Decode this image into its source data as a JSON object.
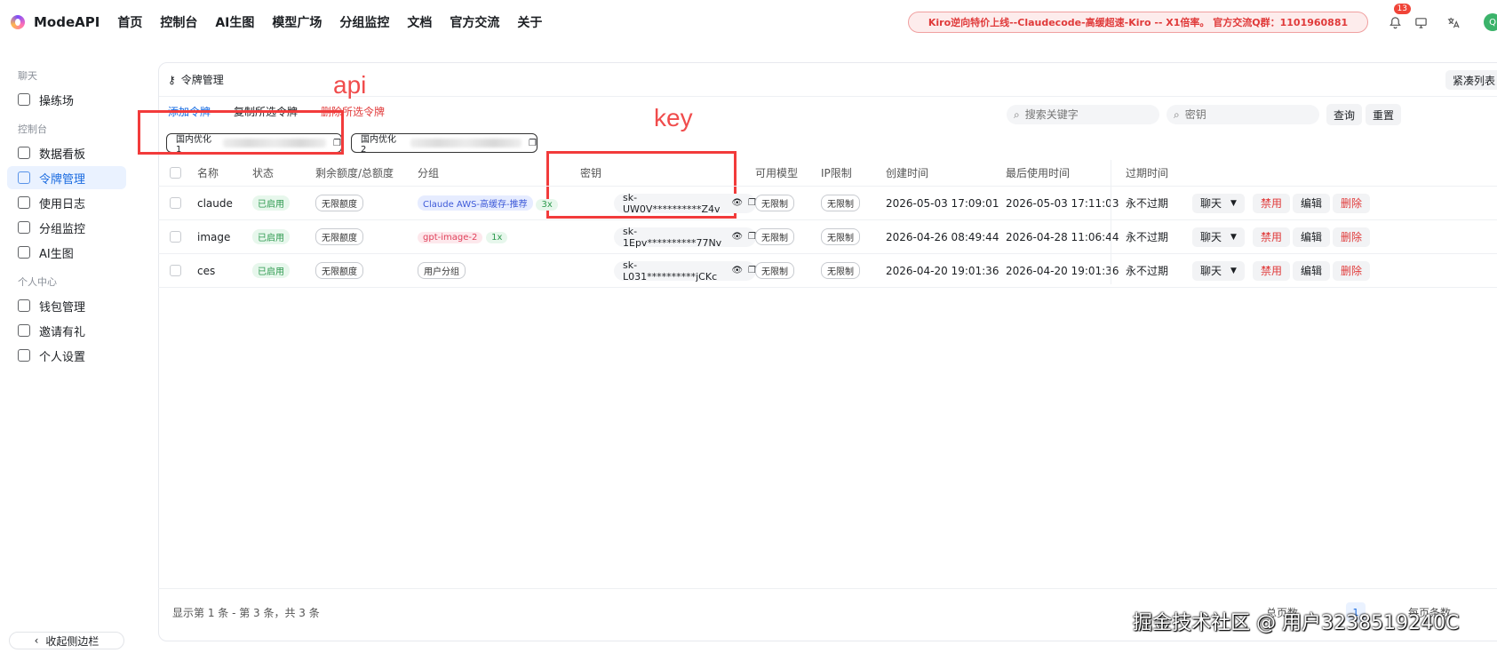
{
  "app": {
    "name": "ModeAPI"
  },
  "nav": [
    "首页",
    "控制台",
    "AI生图",
    "模型广场",
    "分组监控",
    "文档",
    "官方交流",
    "关于"
  ],
  "announcement": "Kiro逆向特价上线--Claudecode-高缓超速-Kiro -- X1倍率。 官方交流Q群：1101960881",
  "notifications": {
    "count": "13"
  },
  "avatar": {
    "initial": "Q"
  },
  "sidebar": {
    "groups": [
      {
        "label": "聊天",
        "items": [
          {
            "label": "操练场",
            "icon": "playground-icon"
          }
        ]
      },
      {
        "label": "控制台",
        "items": [
          {
            "label": "数据看板",
            "icon": "dashboard-icon"
          },
          {
            "label": "令牌管理",
            "icon": "key-icon",
            "active": true
          },
          {
            "label": "使用日志",
            "icon": "chart-icon"
          },
          {
            "label": "分组监控",
            "icon": "pulse-icon"
          },
          {
            "label": "AI生图",
            "icon": "image-icon"
          }
        ]
      },
      {
        "label": "个人中心",
        "items": [
          {
            "label": "钱包管理",
            "icon": "wallet-icon"
          },
          {
            "label": "邀请有礼",
            "icon": "gift-icon"
          },
          {
            "label": "个人设置",
            "icon": "user-icon"
          }
        ]
      }
    ],
    "collapse_label": "收起侧边栏"
  },
  "page": {
    "title": "令牌管理",
    "compact_label": "紧凑列表",
    "actions": {
      "add": "添加令牌",
      "copy": "复制所选令牌",
      "delete": "删除所选令牌"
    },
    "search": {
      "keyword_placeholder": "搜索关键字",
      "key_placeholder": "密钥",
      "query": "查询",
      "reset": "重置"
    },
    "api_pills": [
      "国内优化1",
      "国内优化2"
    ]
  },
  "annotations": {
    "api": "api",
    "key": "key"
  },
  "table": {
    "headers": [
      "名称",
      "状态",
      "剩余额度/总额度",
      "分组",
      "密钥",
      "可用模型",
      "IP限制",
      "创建时间",
      "最后使用时间",
      "过期时间"
    ],
    "rows": [
      {
        "name": "claude",
        "status": "已启用",
        "quota": "无限额度",
        "group": "Claude AWS-高缓存-推荐",
        "ratio": "3x",
        "key": "sk-UW0V**********Z4v",
        "models": "无限制",
        "ip": "无限制",
        "created": "2026-05-03 17:09:01",
        "last_used": "2026-05-03 17:11:03",
        "expires": "永不过期"
      },
      {
        "name": "image",
        "status": "已启用",
        "quota": "无限额度",
        "group": "gpt-image-2",
        "ratio": "1x",
        "key": "sk-1Epv**********77Nv",
        "models": "无限制",
        "ip": "无限制",
        "created": "2026-04-26 08:49:44",
        "last_used": "2026-04-28 11:06:44",
        "expires": "永不过期"
      },
      {
        "name": "ces",
        "status": "已启用",
        "quota": "无限额度",
        "group": "用户分组",
        "ratio": "",
        "key": "sk-L031**********jCKc",
        "models": "无限制",
        "ip": "无限制",
        "created": "2026-04-20 19:01:36",
        "last_used": "2026-04-20 19:01:36",
        "expires": "永不过期"
      }
    ],
    "ops": {
      "chat": "聊天",
      "disable": "禁用",
      "edit": "编辑",
      "delete": "删除"
    }
  },
  "footer": {
    "info": "显示第 1 条 - 第 3 条，共 3 条",
    "total_label": "总页数",
    "page": "1",
    "per_page_label": "每页条数"
  },
  "watermark": "掘金技术社区 @ 用户3238519240C"
}
